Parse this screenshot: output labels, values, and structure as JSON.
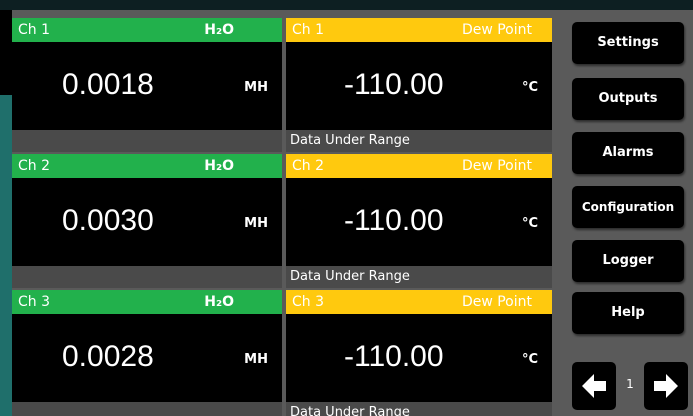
{
  "channels": [
    {
      "h2o": {
        "channel": "Ch 1",
        "measure": "H₂O",
        "value": "0.0018",
        "unit": "MH"
      },
      "dew": {
        "channel": "Ch 1",
        "measure": "Dew Point",
        "value": "-110.00",
        "unit": "°C",
        "status": "Data Under Range"
      }
    },
    {
      "h2o": {
        "channel": "Ch 2",
        "measure": "H₂O",
        "value": "0.0030",
        "unit": "MH"
      },
      "dew": {
        "channel": "Ch 2",
        "measure": "Dew Point",
        "value": "-110.00",
        "unit": "°C",
        "status": "Data Under Range"
      }
    },
    {
      "h2o": {
        "channel": "Ch 3",
        "measure": "H₂O",
        "value": "0.0028",
        "unit": "MH"
      },
      "dew": {
        "channel": "Ch 3",
        "measure": "Dew Point",
        "value": "-110.00",
        "unit": "°C",
        "status": "Data Under Range"
      }
    }
  ],
  "sidebar": {
    "buttons": [
      "Settings",
      "Outputs",
      "Alarms",
      "Configuration",
      "Logger",
      "Help"
    ],
    "page_number": "1",
    "prev_icon": "arrow-left-icon",
    "next_icon": "arrow-right-icon"
  },
  "colors": {
    "h2o_header": "#22b14c",
    "dew_header": "#ffc90e",
    "panel_background": "#5a5a5a"
  }
}
